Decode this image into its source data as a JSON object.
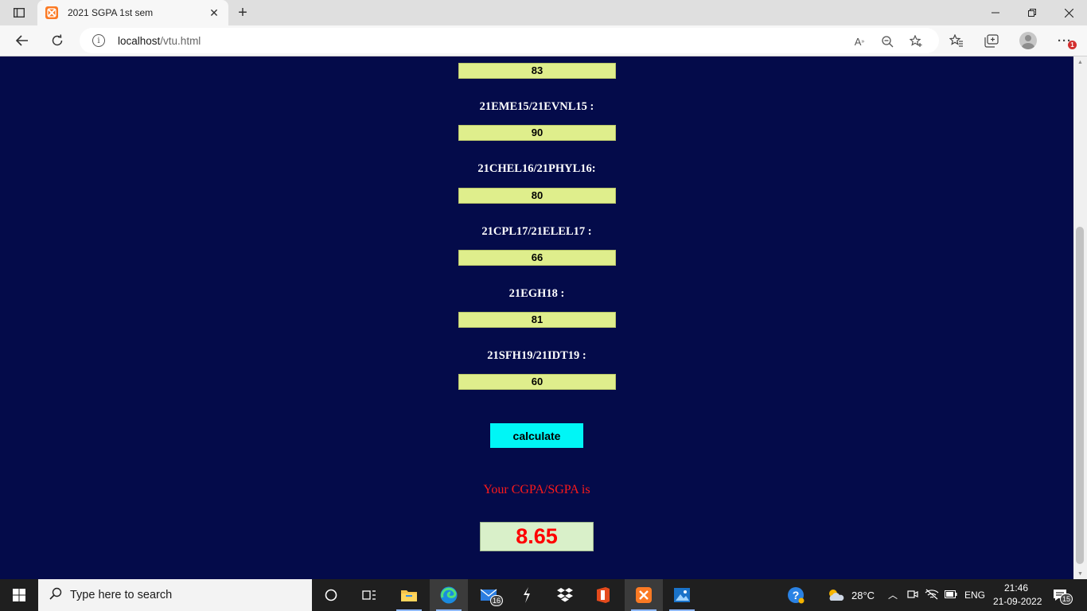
{
  "browser": {
    "tab_title": "2021 SGPA 1st sem",
    "url_host": "localhost",
    "url_path": "/vtu.html"
  },
  "page": {
    "first_value": "83",
    "subjects": [
      {
        "label": "21EME15/21EVNL15 :",
        "value": "90"
      },
      {
        "label": "21CHEL16/21PHYL16:",
        "value": "80"
      },
      {
        "label": "21CPL17/21ELEL17 :",
        "value": "66"
      },
      {
        "label": "21EGH18 :",
        "value": "81"
      },
      {
        "label": "21SFH19/21IDT19 :",
        "value": "60"
      }
    ],
    "calculate_label": "calculate",
    "result_label": "Your CGPA/SGPA is",
    "result_value": "8.65"
  },
  "taskbar": {
    "search_placeholder": "Type here to search",
    "mail_badge": "16",
    "weather": "28°C",
    "language": "ENG",
    "time": "21:46",
    "date": "21-09-2022",
    "notification_count": "15"
  },
  "colors": {
    "page_bg": "#040b4a",
    "input_bg": "#dfee8c",
    "button_bg": "#00f6f6",
    "result_text": "#ff0000",
    "result_bg": "#d9f0c9"
  }
}
